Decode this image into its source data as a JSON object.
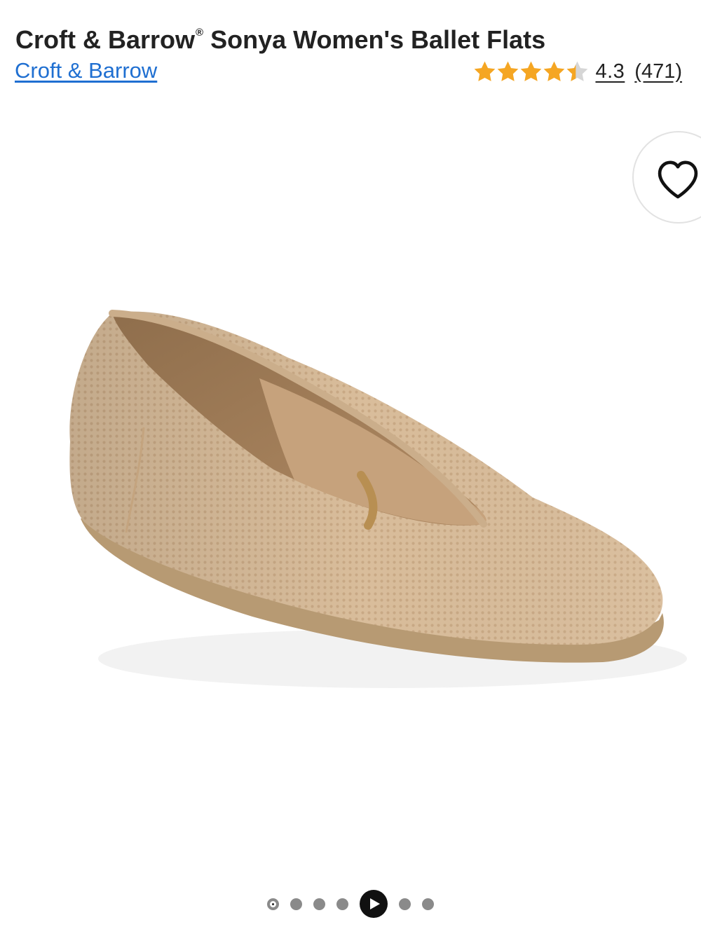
{
  "product": {
    "title_pre": "Croft & Barrow",
    "title_reg": "®",
    "title_post": " Sonya Women's Ballet Flats",
    "brand_link": "Croft & Barrow",
    "rating_value": "4.3",
    "rating_count": "(471)",
    "stars": 4.3,
    "star_color": "#f5a623",
    "star_empty_color": "#d6d6d6"
  },
  "icons": {
    "wishlist": "heart-icon",
    "play": "play-icon"
  },
  "carousel": {
    "count": 7,
    "active_index": 4
  },
  "colors": {
    "link": "#1f6fd1",
    "shoe_knit": "#d8bc9a",
    "sole": "#b79a73"
  }
}
